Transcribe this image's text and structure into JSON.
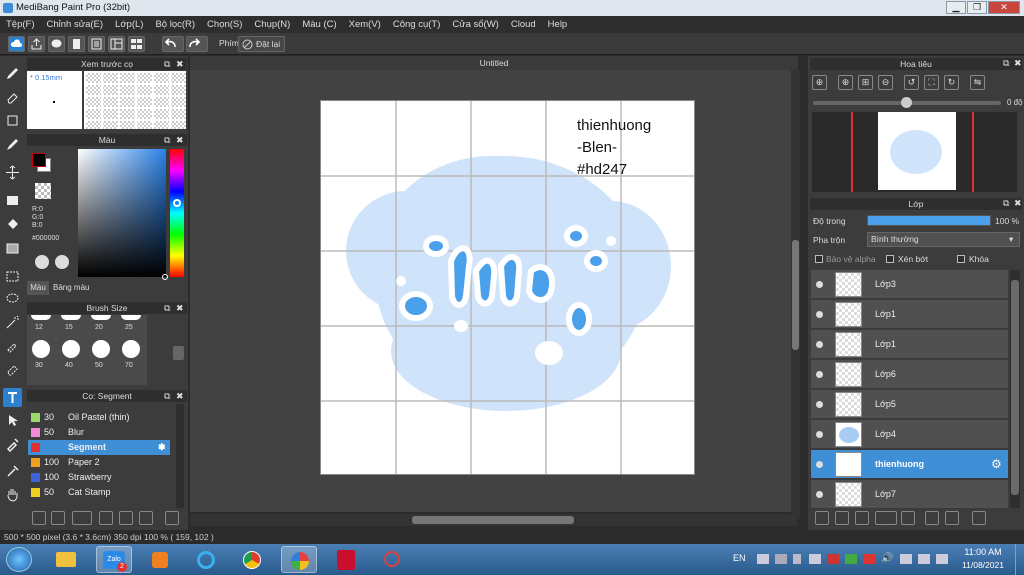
{
  "window": {
    "title": "MediBang Paint Pro (32bit)",
    "btn_min": "▁",
    "btn_max": "❐",
    "btn_close": "✕"
  },
  "menu": [
    "Tệp(F)",
    "Chỉnh sửa(E)",
    "Lớp(L)",
    "Bộ lọc(R)",
    "Chọn(S)",
    "Chụp(N)",
    "Màu (C)",
    "Xem(V)",
    "Công cụ(T)",
    "Cửa sổ(W)",
    "Cloud",
    "Help"
  ],
  "toolbar": {
    "shortcut_label": "Phím",
    "reset_label": "Đặt lại"
  },
  "brush_preview": {
    "title": "Xem trước cọ",
    "size": "* 0.15mm"
  },
  "color_panel": {
    "title": "Màu",
    "r": "R:0",
    "g": "G:0",
    "b": "B:0",
    "hex": "#000000",
    "tab_color": "Màu",
    "tab_palette": "Bảng màu",
    "primary_color": "#cc0000",
    "secondary_color": "#ffffff"
  },
  "brush_size": {
    "title": "Brush Size",
    "sizes_row1": [
      "12",
      "15",
      "20",
      "25"
    ],
    "sizes_row2": [
      "30",
      "40",
      "50",
      "70"
    ]
  },
  "brush_list": {
    "title": "Cọ: Segment",
    "items": [
      {
        "size": "30",
        "name": "Oil Pastel (thin)",
        "color": "#9ed86b"
      },
      {
        "size": "50",
        "name": "Blur",
        "color": "#f08ad8"
      },
      {
        "size": "",
        "name": "Segment",
        "color": "#e03030",
        "selected": true
      },
      {
        "size": "100",
        "name": "Paper 2",
        "color": "#f0a020"
      },
      {
        "size": "100",
        "name": "Strawberry",
        "color": "#3c64d8"
      },
      {
        "size": "50",
        "name": "Cat Stamp",
        "color": "#f0d020"
      }
    ]
  },
  "document": {
    "tab_title": "Untitled",
    "text_line1": "thienhuong",
    "text_line2": "-Blen-",
    "text_line3": "#hd247"
  },
  "navigator": {
    "title": "Hoa tiêu",
    "rotation": "0 độ",
    "zoom_slider_value": 0.5
  },
  "layer_panel": {
    "title": "Lớp",
    "opacity_label": "Độ trong",
    "opacity_value": "100 %",
    "opacity_fraction": 1.0,
    "blend_label": "Pha trộn",
    "blend_value": "Bình thường",
    "protect_alpha": "Bảo vệ alpha",
    "clip": "Xén bớt",
    "lock": "Khóa",
    "layers": [
      {
        "name": "Lớp3",
        "selected": false
      },
      {
        "name": "Lớp1",
        "selected": false
      },
      {
        "name": "Lớp1",
        "selected": false
      },
      {
        "name": "Lớp6",
        "selected": false
      },
      {
        "name": "Lớp5",
        "selected": false
      },
      {
        "name": "Lớp4",
        "selected": false
      },
      {
        "name": "thienhuong",
        "selected": true
      },
      {
        "name": "Lớp7",
        "selected": false
      }
    ]
  },
  "status": {
    "text": "500 * 500 pixel  (3.6 * 3.6cm)  350 dpi  100 %  ( 159, 102 )"
  },
  "taskbar": {
    "lang": "EN",
    "time": "11:00 AM",
    "date": "11/08/2021",
    "zalo_badge": "2",
    "zalo_label": "Zalo"
  }
}
